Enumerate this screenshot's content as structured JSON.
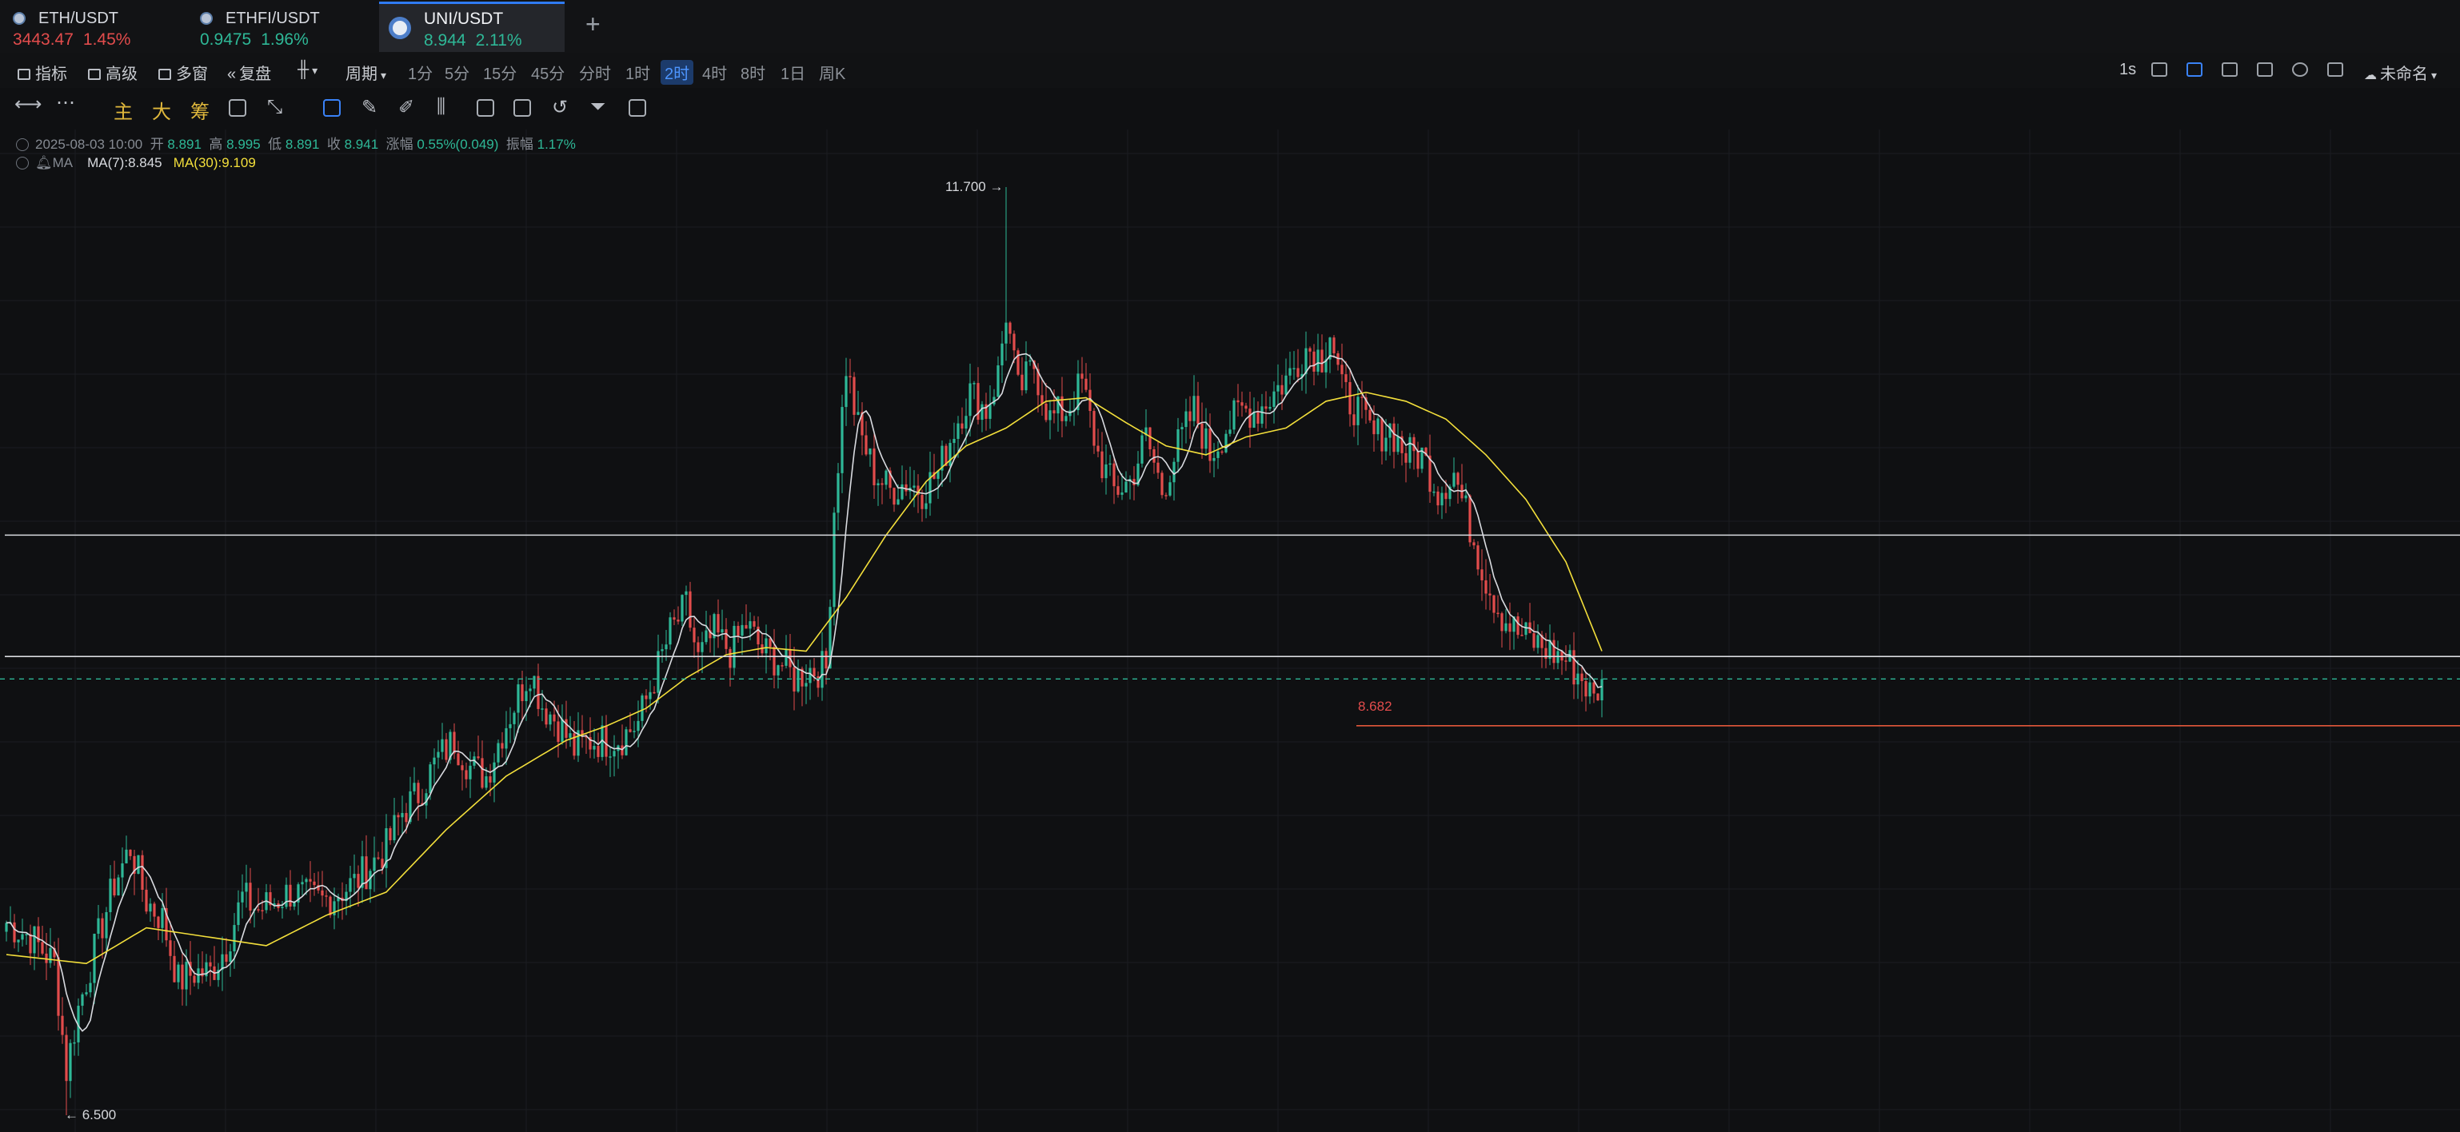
{
  "tabs": [
    {
      "symbol": "ETH/USDT",
      "price": "3443.47",
      "change": "1.45%",
      "dir": "down"
    },
    {
      "symbol": "ETHFI/USDT",
      "price": "0.9475",
      "change": "1.96%",
      "dir": "up"
    },
    {
      "symbol": "UNI/USDT",
      "price": "8.944",
      "change": "2.11%",
      "dir": "up",
      "active": true
    }
  ],
  "add_tab": "+",
  "toolbar": {
    "indicators": "指标",
    "advanced": "高级",
    "multi_window": "多窗",
    "replay": "复盘",
    "period": "周期",
    "timeframes": [
      "1分",
      "5分",
      "15分",
      "45分",
      "分时",
      "1时",
      "2时",
      "4时",
      "8时",
      "1日",
      "周K"
    ],
    "selected_timeframe": "2时",
    "interval": "1s",
    "layout_name": "未命名"
  },
  "tools": {
    "main": "主",
    "big": "大",
    "chips": "筹"
  },
  "ohlc": {
    "time": "2025-08-03 10:00",
    "open_label": "开",
    "open": "8.891",
    "high_label": "高",
    "high": "8.995",
    "low_label": "低",
    "low": "8.891",
    "close_label": "收",
    "close": "8.941",
    "change_label": "涨幅",
    "change": "0.55%(0.049)",
    "amp_label": "振幅",
    "amp": "1.17%"
  },
  "ma": {
    "label": "MA",
    "ma7": "MA(7):8.845",
    "ma30": "MA(30):9.109"
  },
  "colors": {
    "up": "#2eb897",
    "down": "#e24c4c",
    "ma7": "#d9dbe0",
    "ma30": "#f3df3b",
    "accent": "#2f7cf6"
  },
  "chart_data": {
    "type": "candlestick",
    "symbol": "UNI/USDT",
    "interval": "2h",
    "annotations": {
      "high_label": "11.700",
      "low_label": "6.500",
      "support_label": "8.682"
    },
    "high": 11.7,
    "low": 6.5,
    "support": 8.682,
    "last": 8.944,
    "horizontal_lines": [
      9.75,
      9.07
    ],
    "close_path": [
      [
        0,
        7.58
      ],
      [
        6,
        7.5
      ],
      [
        12,
        7.35
      ],
      [
        15,
        6.75
      ],
      [
        18,
        7.1
      ],
      [
        23,
        7.5
      ],
      [
        27,
        7.8
      ],
      [
        31,
        8.0
      ],
      [
        35,
        7.7
      ],
      [
        39,
        7.6
      ],
      [
        43,
        7.25
      ],
      [
        47,
        7.3
      ],
      [
        51,
        7.3
      ],
      [
        55,
        7.45
      ],
      [
        59,
        7.72
      ],
      [
        63,
        7.65
      ],
      [
        67,
        7.7
      ],
      [
        71,
        7.75
      ],
      [
        75,
        7.72
      ],
      [
        79,
        7.7
      ],
      [
        83,
        7.75
      ],
      [
        87,
        7.8
      ],
      [
        91,
        7.9
      ],
      [
        95,
        8.0
      ],
      [
        99,
        8.2
      ],
      [
        103,
        8.3
      ],
      [
        108,
        8.5
      ],
      [
        112,
        8.6
      ],
      [
        116,
        8.45
      ],
      [
        120,
        8.4
      ],
      [
        124,
        8.65
      ],
      [
        128,
        8.85
      ],
      [
        131,
        9.0
      ],
      [
        134,
        8.8
      ],
      [
        138,
        8.7
      ],
      [
        142,
        8.55
      ],
      [
        146,
        8.6
      ],
      [
        150,
        8.6
      ],
      [
        154,
        8.62
      ],
      [
        158,
        8.7
      ],
      [
        162,
        8.95
      ],
      [
        166,
        9.2
      ],
      [
        170,
        9.35
      ],
      [
        173,
        9.05
      ],
      [
        177,
        9.2
      ],
      [
        181,
        9.1
      ],
      [
        185,
        9.25
      ],
      [
        189,
        9.1
      ],
      [
        193,
        9.05
      ],
      [
        197,
        8.95
      ],
      [
        201,
        9.0
      ],
      [
        205,
        9.0
      ],
      [
        207,
        9.9
      ],
      [
        210,
        10.7
      ],
      [
        213,
        10.35
      ],
      [
        217,
        10.1
      ],
      [
        221,
        10.0
      ],
      [
        225,
        10.05
      ],
      [
        229,
        10.0
      ],
      [
        233,
        10.1
      ],
      [
        237,
        10.35
      ],
      [
        241,
        10.55
      ],
      [
        245,
        10.45
      ],
      [
        248,
        10.65
      ],
      [
        250,
        11.0
      ],
      [
        253,
        10.55
      ],
      [
        257,
        10.7
      ],
      [
        261,
        10.4
      ],
      [
        265,
        10.45
      ],
      [
        269,
        10.6
      ],
      [
        273,
        10.2
      ],
      [
        277,
        10.0
      ],
      [
        281,
        10.05
      ],
      [
        285,
        10.3
      ],
      [
        289,
        10.0
      ],
      [
        293,
        10.25
      ],
      [
        297,
        10.45
      ],
      [
        301,
        10.2
      ],
      [
        305,
        10.35
      ],
      [
        309,
        10.45
      ],
      [
        313,
        10.45
      ],
      [
        317,
        10.55
      ],
      [
        321,
        10.65
      ],
      [
        325,
        10.8
      ],
      [
        329,
        10.75
      ],
      [
        331,
        10.9
      ],
      [
        334,
        10.55
      ],
      [
        338,
        10.45
      ],
      [
        342,
        10.3
      ],
      [
        346,
        10.35
      ],
      [
        350,
        10.2
      ],
      [
        354,
        10.2
      ],
      [
        358,
        10.0
      ],
      [
        362,
        10.1
      ],
      [
        366,
        9.8
      ],
      [
        370,
        9.5
      ],
      [
        374,
        9.3
      ],
      [
        378,
        9.2
      ],
      [
        382,
        9.15
      ],
      [
        386,
        9.1
      ],
      [
        390,
        9.05
      ],
      [
        394,
        8.95
      ],
      [
        397,
        8.82
      ],
      [
        399,
        8.96
      ]
    ],
    "ma30_path": [
      [
        0,
        7.4
      ],
      [
        20,
        7.35
      ],
      [
        35,
        7.55
      ],
      [
        50,
        7.5
      ],
      [
        65,
        7.45
      ],
      [
        80,
        7.62
      ],
      [
        95,
        7.75
      ],
      [
        110,
        8.1
      ],
      [
        125,
        8.4
      ],
      [
        140,
        8.6
      ],
      [
        150,
        8.68
      ],
      [
        160,
        8.78
      ],
      [
        170,
        8.95
      ],
      [
        180,
        9.08
      ],
      [
        190,
        9.12
      ],
      [
        200,
        9.1
      ],
      [
        210,
        9.4
      ],
      [
        220,
        9.75
      ],
      [
        230,
        10.05
      ],
      [
        240,
        10.25
      ],
      [
        250,
        10.35
      ],
      [
        260,
        10.5
      ],
      [
        270,
        10.52
      ],
      [
        280,
        10.38
      ],
      [
        290,
        10.25
      ],
      [
        300,
        10.2
      ],
      [
        310,
        10.3
      ],
      [
        320,
        10.35
      ],
      [
        330,
        10.5
      ],
      [
        340,
        10.55
      ],
      [
        350,
        10.5
      ],
      [
        360,
        10.4
      ],
      [
        370,
        10.2
      ],
      [
        380,
        9.95
      ],
      [
        390,
        9.6
      ],
      [
        399,
        9.1
      ]
    ],
    "ylim": [
      6.3,
      11.9
    ],
    "y_axis_label": "",
    "x_axis_label": "",
    "grid": true
  }
}
